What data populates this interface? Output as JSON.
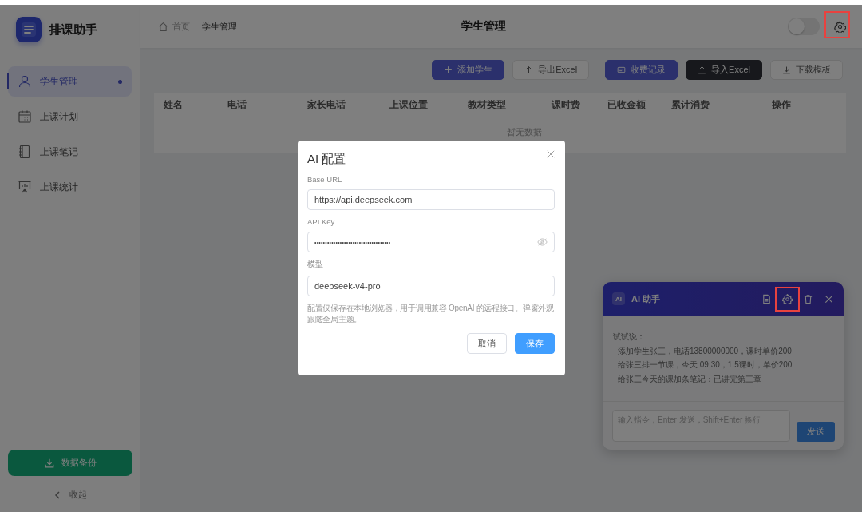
{
  "app": {
    "logo_title": "排课助手"
  },
  "sidebar": {
    "items": [
      {
        "label": "学生管理",
        "selected": true
      },
      {
        "label": "上课计划",
        "selected": false
      },
      {
        "label": "上课笔记",
        "selected": false
      },
      {
        "label": "上课统计",
        "selected": false
      }
    ],
    "backup_button": "数据备份",
    "collapse": "收起"
  },
  "header": {
    "breadcrumb": [
      "首页",
      "学生管理"
    ],
    "title": "学生管理",
    "theme_toggle": {
      "on": false
    },
    "settings_highlighted": true
  },
  "toolbar": {
    "buttons": [
      {
        "label": "添加学生",
        "kind": "primary"
      },
      {
        "label": "导出Excel",
        "kind": "plain"
      },
      {
        "label": "收费记录",
        "kind": "primary"
      },
      {
        "label": "导入Excel",
        "kind": "dark"
      },
      {
        "label": "下载模板",
        "kind": "plain"
      }
    ]
  },
  "table": {
    "columns": [
      "姓名",
      "电话",
      "家长电话",
      "上课位置",
      "教材类型",
      "课时费",
      "已收金额",
      "累计消费",
      "操作"
    ],
    "empty_text": "暂无数据"
  },
  "dialog": {
    "title": "AI 配置",
    "fields": [
      {
        "label": "Base URL",
        "value": "https://api.deepseek.com",
        "kind": "text"
      },
      {
        "label": "API Key",
        "value": "••••••••••••••••••••••••••••••••••••",
        "kind": "password"
      },
      {
        "label": "模型",
        "value": "deepseek-v4-pro",
        "kind": "text"
      }
    ],
    "note": "配置仅保存在本地浏览器，用于调用兼容 OpenAI 的远程接口。弹窗外观跟随全局主题。",
    "buttons": [
      {
        "label": "取消",
        "kind": "default"
      },
      {
        "label": "保存",
        "kind": "primary"
      }
    ]
  },
  "assistant": {
    "badge": "AI",
    "title": "AI 助手",
    "settings_highlighted": true,
    "hint_title": "试试说：",
    "examples": [
      "添加学生张三，电话13800000000，课时单价200",
      "给张三排一节课，今天 09:30，1.5课时，单价200",
      "给张三今天的课加条笔记：已讲完第三章"
    ],
    "input": {
      "placeholder": "输入指令，Enter 发送，Shift+Enter 换行"
    },
    "send": "发送"
  }
}
